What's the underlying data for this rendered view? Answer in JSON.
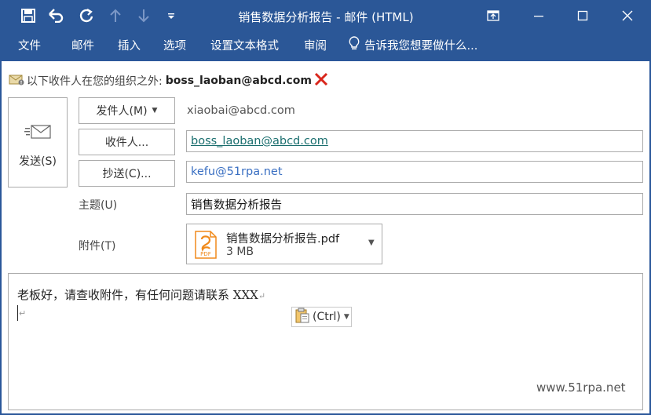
{
  "window": {
    "title": "销售数据分析报告 - 邮件 (HTML)"
  },
  "quick_access": [
    "save-icon",
    "undo-icon",
    "redo-icon",
    "up-arrow-icon",
    "down-arrow-icon",
    "customize-icon"
  ],
  "menu": {
    "items": [
      "文件",
      "邮件",
      "插入",
      "选项",
      "设置文本格式",
      "审阅"
    ],
    "tell_me": "告诉我您想要做什么..."
  },
  "warning": {
    "text": "以下收件人在您的组织之外:",
    "address": "boss_laoban@abcd.com"
  },
  "send": {
    "label": "发送(S)"
  },
  "fields": {
    "from_button": "发件人(M)",
    "from_value": "xiaobai@abcd.com",
    "to_button": "收件人...",
    "to_value": "boss_laoban@abcd.com",
    "cc_button": "抄送(C)...",
    "cc_value": "kefu@51rpa.net",
    "subject_label": "主题(U)",
    "subject_value": "销售数据分析报告",
    "attach_label": "附件(T)"
  },
  "attachment": {
    "name": "销售数据分析报告.pdf",
    "size": "3 MB",
    "icon_text": "PDF"
  },
  "body": {
    "text": "老板好，请查收附件，有任何问题请联系 XXX",
    "paste_label": "(Ctrl)",
    "watermark": "www.51rpa.net"
  },
  "colors": {
    "titlebar": "#2b5797",
    "link_to": "#1a6e6e",
    "link_cc": "#3a6fc2",
    "error_x": "#d9261c",
    "pdf_orange": "#f08a1c"
  }
}
